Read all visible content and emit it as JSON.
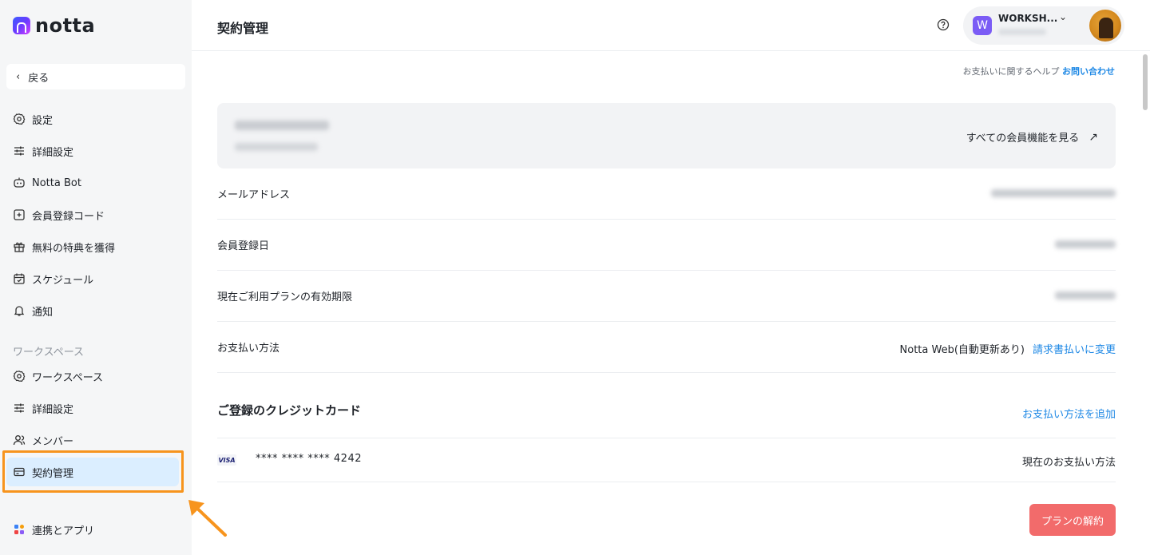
{
  "app": {
    "logo_text": "notta",
    "page_title": "契約管理"
  },
  "sidebar": {
    "back_label": "戻る",
    "items": [
      {
        "label": "設定",
        "icon": "gear-icon"
      },
      {
        "label": "詳細設定",
        "icon": "sliders-icon"
      },
      {
        "label": "Notta Bot",
        "icon": "bot-icon"
      },
      {
        "label": "会員登録コード",
        "icon": "code-icon"
      },
      {
        "label": "無料の特典を獲得",
        "icon": "gift-icon"
      },
      {
        "label": "スケジュール",
        "icon": "calendar-icon"
      },
      {
        "label": "通知",
        "icon": "bell-icon"
      }
    ],
    "workspace_section_label": "ワークスペース",
    "workspace_items": [
      {
        "label": "ワークスペース",
        "icon": "gear-icon"
      },
      {
        "label": "詳細設定",
        "icon": "sliders-icon"
      },
      {
        "label": "メンバー",
        "icon": "members-icon"
      },
      {
        "label": "契約管理",
        "icon": "billing-icon",
        "active": true
      }
    ],
    "integrations_label": "連携とアプリ"
  },
  "header": {
    "workspace_initial": "W",
    "workspace_name": "WORKSH..."
  },
  "content": {
    "help_text": "お支払いに関するヘルプ",
    "help_link": "お問い合わせ",
    "see_all_features": "すべての会員機能を見る",
    "rows": {
      "email_label": "メールアドレス",
      "registered_label": "会員登録日",
      "expiry_label": "現在ご利用プランの有効期限",
      "payment_label": "お支払い方法",
      "payment_value": "Notta Web(自動更新あり)",
      "payment_change_link": "請求書払いに変更"
    },
    "credit_card": {
      "title": "ご登録のクレジットカード",
      "add_link": "お支払い方法を追加",
      "brand": "VISA",
      "number": "**** **** **** 4242",
      "status": "現在のお支払い方法"
    },
    "cancel_button": "プランの解約"
  },
  "colors": {
    "accent": "#1e88e5",
    "danger": "#f26b6b",
    "highlight": "#f7941d",
    "active_bg": "#dbeeff"
  }
}
